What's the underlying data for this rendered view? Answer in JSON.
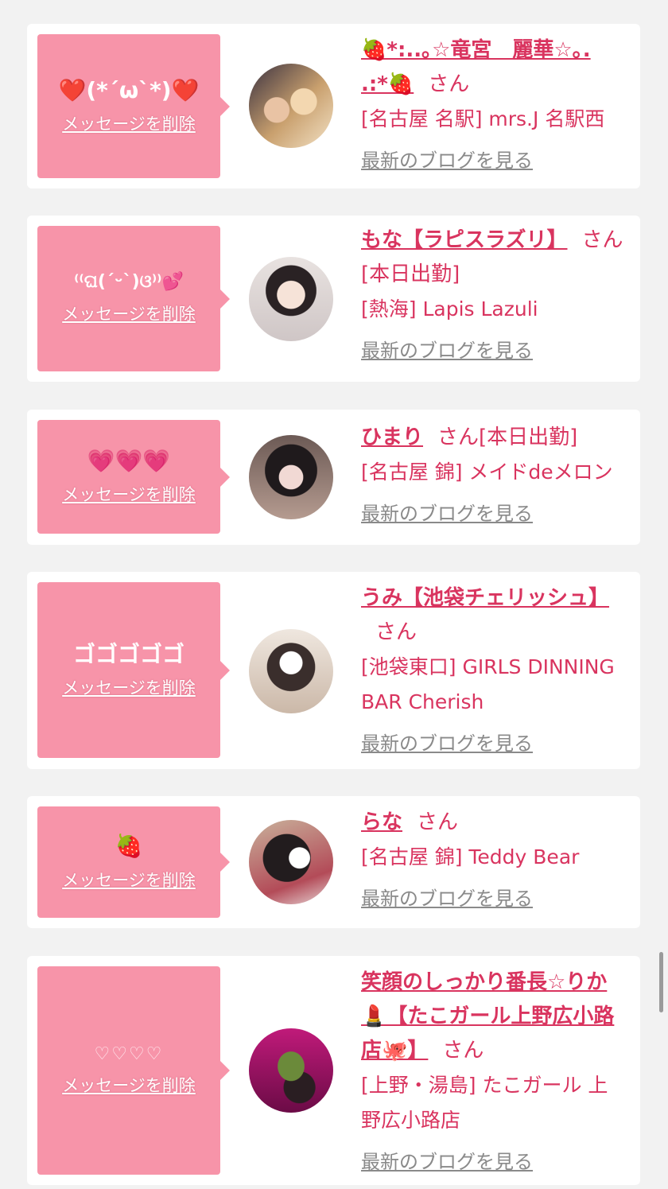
{
  "cards": [
    {
      "message": "❤️(*´ω`*)❤️",
      "delete_label": "メッセージを削除",
      "name": "🍓*:..｡☆竜宮　麗華☆｡. .:*🍓",
      "san": "さん",
      "status": "",
      "shop": "[名古屋 名駅] mrs.J 名駅西",
      "blog_label": "最新のブログを見る"
    },
    {
      "message": "⁽⁽ଘ(ˊᵕˋ)ଓ⁾⁾💕",
      "delete_label": "メッセージを削除",
      "name": "もな【ラピスラズリ】",
      "san": "さん",
      "status": "[本日出勤]",
      "shop": "[熱海] Lapis Lazuli",
      "blog_label": "最新のブログを見る"
    },
    {
      "message": "💗💗💗",
      "delete_label": "メッセージを削除",
      "name": "ひまり",
      "san": "さん",
      "status": "[本日出勤]",
      "shop": "[名古屋 錦] メイドdeメロン",
      "blog_label": "最新のブログを見る"
    },
    {
      "message": "ゴゴゴゴゴ",
      "delete_label": "メッセージを削除",
      "name": "うみ【池袋チェリッシュ】",
      "san": "さん",
      "status": "",
      "shop": "[池袋東口] GIRLS DINNING BAR Cherish",
      "blog_label": "最新のブログを見る"
    },
    {
      "message": "🍓",
      "delete_label": "メッセージを削除",
      "name": "らな",
      "san": "さん",
      "status": "",
      "shop": "[名古屋 錦] Teddy Bear",
      "blog_label": "最新のブログを見る"
    },
    {
      "message": "♡♡♡♡",
      "delete_label": "メッセージを削除",
      "name": "笑顔のしっかり番長☆りか💄【たこガール上野広小路店🐙】",
      "san": "さん",
      "status": "",
      "shop": "[上野・湯島] たこガール 上野広小路店",
      "blog_label": "最新のブログを見る"
    }
  ],
  "colors": {
    "accent": "#d9345f",
    "message_bg": "#f794a9",
    "page_bg": "#f2f2f2"
  }
}
